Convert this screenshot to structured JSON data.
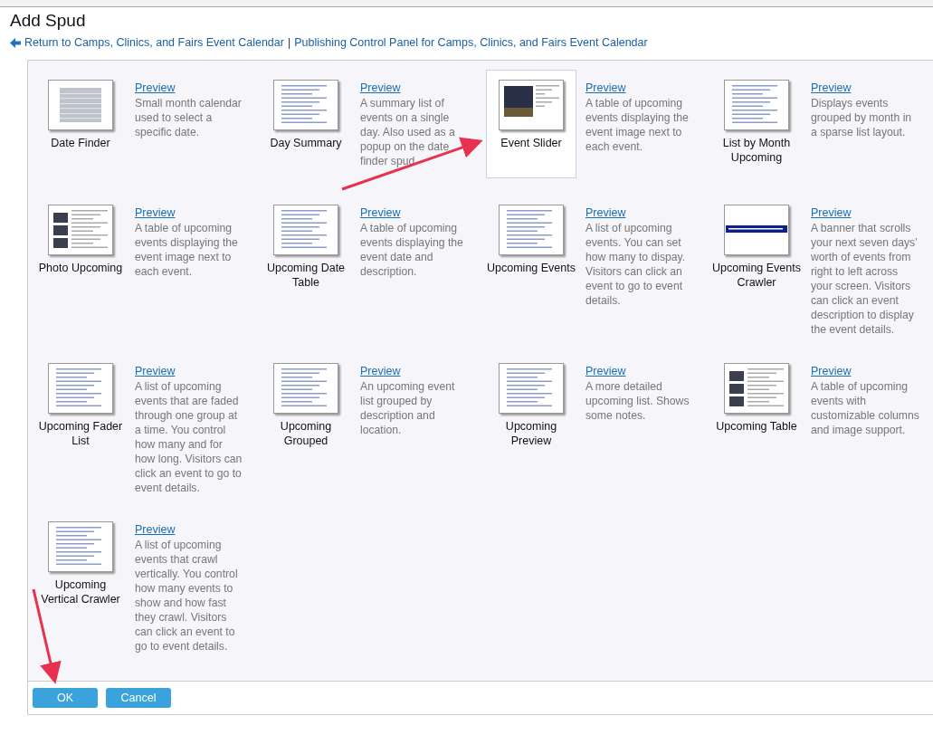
{
  "title": "Add Spud",
  "links": [
    {
      "label": "Return to Camps, Clinics, and Fairs Event Calendar"
    },
    {
      "label": "Publishing Control Panel for Camps, Clinics, and Fairs Event Calendar"
    }
  ],
  "separator": "|",
  "spuds": [
    {
      "label": "Date Finder",
      "kind": "calendar",
      "link": "Preview",
      "description": "Small month calendar used to select a specific date.",
      "selected": false
    },
    {
      "label": "Day Summary",
      "kind": "list",
      "link": "Preview",
      "description": "A summary list of events on a single day. Also used as a popup on the date finder spud.",
      "selected": false
    },
    {
      "label": "Event Slider",
      "kind": "photo",
      "link": "Preview",
      "description": "A table of upcoming events displaying the event image next to each event.",
      "selected": true
    },
    {
      "label": "List by Month Upcoming",
      "kind": "list",
      "link": "Preview",
      "description": "Displays events grouped by month in a sparse list layout.",
      "selected": false
    },
    {
      "label": "Photo Upcoming",
      "kind": "table",
      "link": "Preview",
      "description": "A table of upcoming events displaying the event image next to each event.",
      "selected": false
    },
    {
      "label": "Upcoming Date Table",
      "kind": "list",
      "link": "Preview",
      "description": "A table of upcoming events displaying the event date and description.",
      "selected": false
    },
    {
      "label": "Upcoming Events",
      "kind": "list",
      "link": "Preview",
      "description": "A list of upcoming events. You can set how many to dispay. Visitors can click an event to go to event details.",
      "selected": false
    },
    {
      "label": "Upcoming Events Crawler",
      "kind": "banner",
      "link": "Preview",
      "description": "A banner that scrolls your next seven days' worth of events from right to left across your screen. Visitors can click an event description to display the event details.",
      "selected": false
    },
    {
      "label": "Upcoming Fader List",
      "kind": "list",
      "link": "Preview",
      "description": "A list of upcoming events that are faded through one group at a time. You control how many and for how long. Visitors can click an event to go to event details.",
      "selected": false
    },
    {
      "label": "Upcoming Grouped",
      "kind": "list",
      "link": "Preview",
      "description": "An upcoming event list grouped by description and location.",
      "selected": false
    },
    {
      "label": "Upcoming Preview",
      "kind": "list",
      "link": "Preview",
      "description": "A more detailed upcoming list. Shows some notes.",
      "selected": false
    },
    {
      "label": "Upcoming Table",
      "kind": "table",
      "link": "Preview",
      "description": "A table of upcoming events with customizable columns and image support.",
      "selected": false
    },
    {
      "label": "Upcoming Vertical Crawler",
      "kind": "list",
      "link": "Preview",
      "description": "A list of upcoming events that crawl vertically. You control how many events to show and how fast they crawl. Visitors can click an event to go to event details.",
      "selected": false
    }
  ],
  "buttons": [
    {
      "label": "OK"
    },
    {
      "label": "Cancel"
    }
  ]
}
